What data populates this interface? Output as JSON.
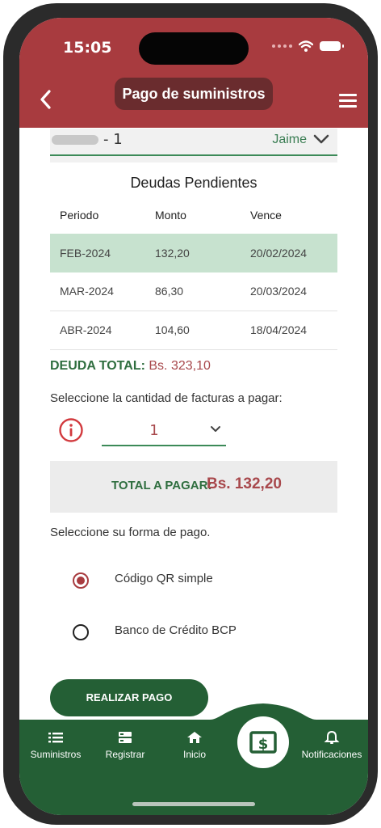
{
  "status_bar": {
    "time": "15:05"
  },
  "header": {
    "title": "Pago de suministros"
  },
  "account": {
    "suffix": "- 1",
    "name": "Jaime"
  },
  "debts": {
    "title": "Deudas Pendientes",
    "columns": [
      "Periodo",
      "Monto",
      "Vence"
    ],
    "rows": [
      {
        "periodo": "FEB-2024",
        "monto": "132,20",
        "vence": "20/02/2024"
      },
      {
        "periodo": "MAR-2024",
        "monto": "86,30",
        "vence": "20/03/2024"
      },
      {
        "periodo": "ABR-2024",
        "monto": "104,60",
        "vence": "18/04/2024"
      }
    ],
    "total_label": "DEUDA TOTAL:",
    "total_value": "Bs. 323,10"
  },
  "invoices": {
    "prompt": "Seleccione la cantidad de facturas a pagar:",
    "selected": "1"
  },
  "to_pay": {
    "label": "TOTAL A PAGAR:",
    "value": "Bs. 132,20"
  },
  "payment": {
    "prompt": "Seleccione su forma de pago.",
    "options": [
      {
        "label": "Código QR simple",
        "selected": true
      },
      {
        "label": "Banco de Crédito BCP",
        "selected": false
      }
    ],
    "button": "REALIZAR PAGO"
  },
  "nav": {
    "items": [
      "Suministros",
      "Registrar",
      "Inicio",
      "Notificaciones"
    ]
  },
  "colors": {
    "primary_red": "#a83b3f",
    "primary_green": "#245f35",
    "highlight_row": "#c7e2cf"
  }
}
